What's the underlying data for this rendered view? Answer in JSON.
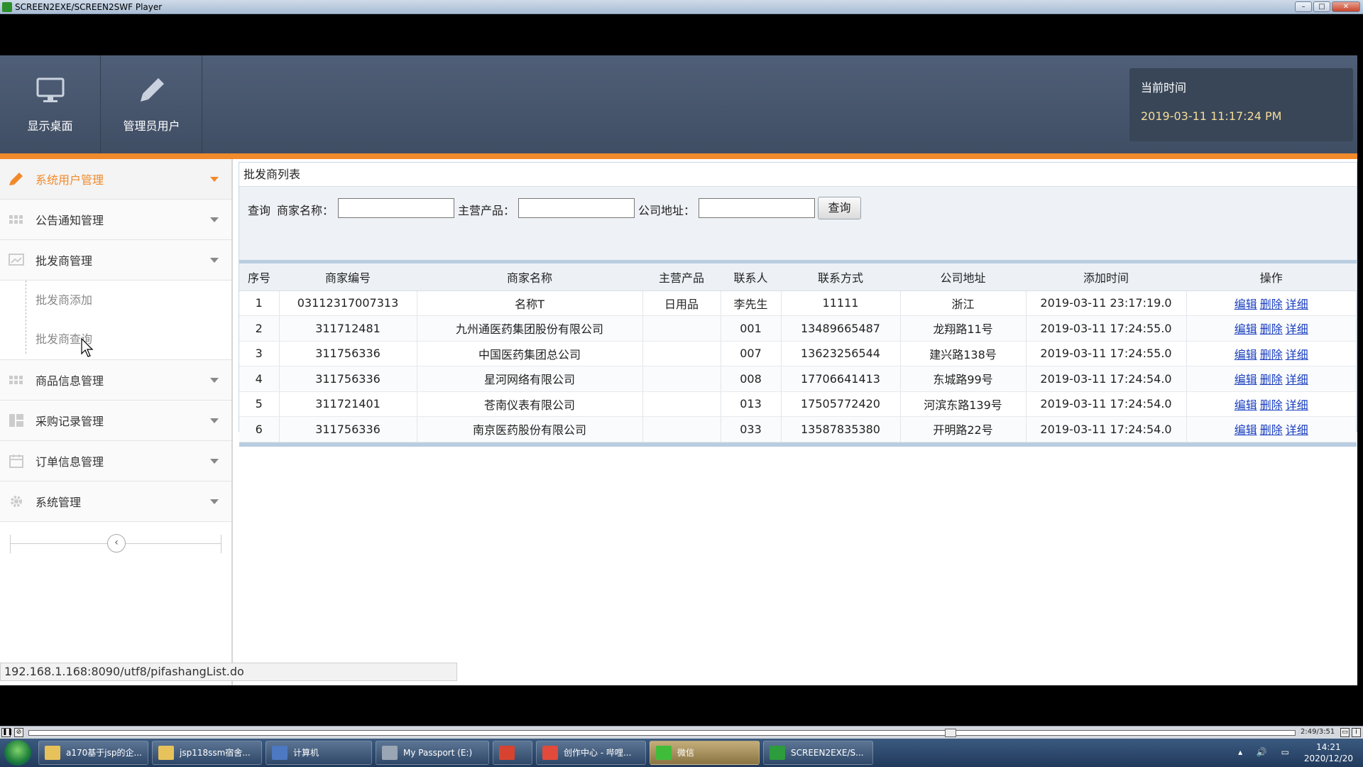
{
  "player": {
    "title": "SCREEN2EXE/SCREEN2SWF Player",
    "time_display": "2:49/3:51"
  },
  "header": {
    "buttons": [
      {
        "label": "显示桌面",
        "icon": "monitor-icon"
      },
      {
        "label": "管理员用户",
        "icon": "pencil-icon"
      }
    ],
    "time_label": "当前时间",
    "time_value": "2019-03-11 11:17:24 PM"
  },
  "sidebar": {
    "items": [
      {
        "label": "系统用户管理",
        "icon": "pencil-icon",
        "active": true
      },
      {
        "label": "公告通知管理",
        "icon": "grid-icon"
      },
      {
        "label": "批发商管理",
        "icon": "image-icon"
      },
      {
        "label": "商品信息管理",
        "icon": "grid-icon"
      },
      {
        "label": "采购记录管理",
        "icon": "layout-icon"
      },
      {
        "label": "订单信息管理",
        "icon": "calendar-icon"
      },
      {
        "label": "系统管理",
        "icon": "gear-icon"
      }
    ],
    "sub_items": [
      "批发商添加",
      "批发商查询"
    ],
    "collapse_symbol": "‹"
  },
  "main": {
    "panel_title": "批发商列表",
    "search": {
      "prefix": "查询",
      "field1_label": "商家名称：",
      "field2_label": "主营产品：",
      "field3_label": "公司地址：",
      "field1_value": "",
      "field2_value": "",
      "field3_value": "",
      "button_label": "查询"
    },
    "table": {
      "columns": [
        "序号",
        "商家编号",
        "商家名称",
        "主营产品",
        "联系人",
        "联系方式",
        "公司地址",
        "添加时间",
        "操作"
      ],
      "rows": [
        [
          "1",
          "03112317007313",
          "名称T",
          "日用品",
          "李先生",
          "11111",
          "浙江",
          "2019-03-11 23:17:19.0"
        ],
        [
          "2",
          "311712481",
          "九州通医药集团股份有限公司",
          "",
          "001",
          "13489665487",
          "龙翔路11号",
          "2019-03-11 17:24:55.0"
        ],
        [
          "3",
          "311756336",
          "中国医药集团总公司",
          "",
          "007",
          "13623256544",
          "建兴路138号",
          "2019-03-11 17:24:55.0"
        ],
        [
          "4",
          "311756336",
          "星河网络有限公司",
          "",
          "008",
          "17706641413",
          "东城路99号",
          "2019-03-11 17:24:54.0"
        ],
        [
          "5",
          "311721401",
          "苍南仪表有限公司",
          "",
          "013",
          "17505772420",
          "河滨东路139号",
          "2019-03-11 17:24:54.0"
        ],
        [
          "6",
          "311756336",
          "南京医药股份有限公司",
          "",
          "033",
          "13587835380",
          "开明路22号",
          "2019-03-11 17:24:54.0"
        ]
      ],
      "actions": [
        "编辑",
        "删除",
        "详细"
      ]
    }
  },
  "status_url": "192.168.1.168:8090/utf8/pifashangList.do",
  "taskbar": {
    "tasks": [
      {
        "label": "a170基于jsp的企...",
        "color": "#e7c25a"
      },
      {
        "label": "jsp118ssm宿舍...",
        "color": "#e7c25a"
      },
      {
        "label": "计算机",
        "color": "#4d78c2"
      },
      {
        "label": "My Passport (E:)",
        "color": "#9aa6b3"
      },
      {
        "label": "",
        "color": "#d8432f"
      },
      {
        "label": "创作中心 - 哔哩...",
        "color": "#e24a3b"
      },
      {
        "label": "微信",
        "color": "#3fbd3a",
        "active": true
      },
      {
        "label": "SCREEN2EXE/S...",
        "color": "#2c9c3c"
      }
    ],
    "clock_time": "14:21",
    "clock_date": "2020/12/20"
  }
}
